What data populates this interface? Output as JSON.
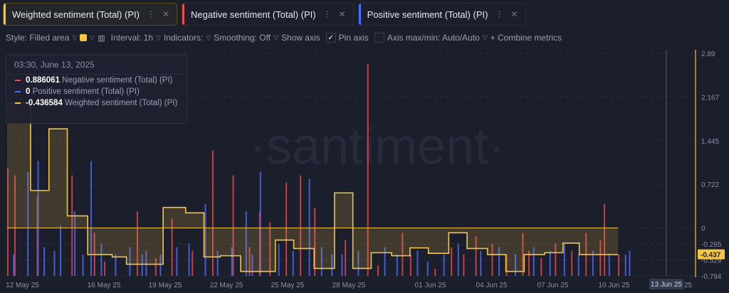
{
  "tabs": [
    {
      "label": "Weighted sentiment (Total) (PI)",
      "color": "#f5c542",
      "active": true
    },
    {
      "label": "Negative sentiment (Total) (PI)",
      "color": "#ef4b4b",
      "active": false
    },
    {
      "label": "Positive sentiment (Total) (PI)",
      "color": "#4b6bff",
      "active": false
    }
  ],
  "toolbar": {
    "style": "Style: Filled area",
    "interval": "Interval: 1h",
    "indicators": "Indicators:",
    "smoothing": "Smoothing: Off",
    "show_axis": "Show axis",
    "pin_axis": "Pin axis",
    "axis_maxmin": "Axis max/min: Auto/Auto",
    "combine": "+ Combine metrics",
    "check": "✓"
  },
  "tooltip": {
    "date": "03:30, June 13, 2025",
    "rows": [
      {
        "value": "0.886061",
        "label": "Negative sentiment (Total) (PI)",
        "color": "#ef4b4b"
      },
      {
        "value": "0",
        "label": "Positive sentiment (Total) (PI)",
        "color": "#4b6bff"
      },
      {
        "value": "-0.436584",
        "label": "Weighted sentiment (Total) (PI)",
        "color": "#f5c542"
      }
    ]
  },
  "watermark": "·santiment·",
  "chart_data": {
    "type": "area",
    "x_ticks": [
      {
        "day": 0,
        "label": "12 May 25"
      },
      {
        "day": 4,
        "label": "16 May 25"
      },
      {
        "day": 7,
        "label": "19 May 25"
      },
      {
        "day": 10,
        "label": "22 May 25"
      },
      {
        "day": 13,
        "label": "25 May 25"
      },
      {
        "day": 16,
        "label": "28 May 25"
      },
      {
        "day": 20,
        "label": "01 Jun 25"
      },
      {
        "day": 23,
        "label": "04 Jun 25"
      },
      {
        "day": 26,
        "label": "07 Jun 25"
      },
      {
        "day": 29,
        "label": "10 Jun 25"
      },
      {
        "day": 32.3,
        "label": "Jun 25"
      }
    ],
    "cursor_label": "13 Jun 25",
    "y_ticks": [
      "2.89",
      "2.167",
      "1.445",
      "0.722",
      "0",
      "-0.265",
      "-0.529",
      "-0.794"
    ],
    "y_tick_values": [
      2.89,
      2.167,
      1.445,
      0.722,
      0,
      -0.265,
      -0.529,
      -0.794
    ],
    "ylim": [
      -0.794,
      2.89
    ],
    "xlim": [
      -0.75,
      33
    ],
    "current_value": "-0.437",
    "weighted_steps": [
      [
        -0.75,
        2.07
      ],
      [
        0.4,
        0.62
      ],
      [
        1.3,
        1.64
      ],
      [
        2.2,
        0.2
      ],
      [
        3.2,
        -0.44
      ],
      [
        4.4,
        -0.48
      ],
      [
        5.1,
        -0.6
      ],
      [
        6.9,
        0.34
      ],
      [
        8,
        0.25
      ],
      [
        8.9,
        -0.48
      ],
      [
        9.7,
        -0.46
      ],
      [
        10.7,
        -0.72
      ],
      [
        12.4,
        -0.2
      ],
      [
        13.3,
        -0.34
      ],
      [
        14.3,
        -0.67
      ],
      [
        15.3,
        0.58
      ],
      [
        16.2,
        -0.67
      ],
      [
        17.1,
        -0.41
      ],
      [
        18.1,
        -0.46
      ],
      [
        19,
        -0.33
      ],
      [
        19.9,
        -0.42
      ],
      [
        20.9,
        -0.08
      ],
      [
        21.8,
        -0.34
      ],
      [
        22.8,
        -0.44
      ],
      [
        23.7,
        -0.72
      ],
      [
        24.6,
        -0.44
      ],
      [
        25.6,
        -0.41
      ],
      [
        26.5,
        -0.25
      ],
      [
        27.3,
        -0.44
      ],
      [
        28.2,
        -0.44
      ]
    ],
    "weighted_end_day": 28.2,
    "negative_bars": [
      [
        -0.75,
        1.5
      ],
      [
        -0.4,
        1.4
      ],
      [
        0.7,
        1.1
      ],
      [
        2.4,
        1.4
      ],
      [
        4,
        0.2
      ],
      [
        5.6,
        0.9
      ],
      [
        6.5,
        0.25
      ],
      [
        8.3,
        0.35
      ],
      [
        9.3,
        1.75
      ],
      [
        10.3,
        1.4
      ],
      [
        11.1,
        0.4
      ],
      [
        12.1,
        0.75
      ],
      [
        12.9,
        1.3
      ],
      [
        13.6,
        1.4
      ],
      [
        14.3,
        0.95
      ],
      [
        16.9,
        2.95
      ],
      [
        17.4,
        0.15
      ],
      [
        19,
        0.3
      ],
      [
        20.2,
        0.1
      ],
      [
        21.6,
        0.3
      ],
      [
        23,
        0.45
      ],
      [
        23.7,
        0.3
      ],
      [
        24.5,
        0.6
      ],
      [
        24.8,
        0.35
      ],
      [
        25.4,
        0.25
      ],
      [
        26.9,
        0.35
      ],
      [
        28.3,
        0.5
      ],
      [
        28.5,
        1.0
      ],
      [
        29.2,
        0.3
      ],
      [
        3.5,
        0.6
      ],
      [
        7.3,
        0.8
      ],
      [
        11.6,
        0.9
      ],
      [
        15.8,
        0.5
      ],
      [
        18.6,
        0.6
      ],
      [
        21,
        0.4
      ],
      [
        22.2,
        0.55
      ],
      [
        26.1,
        0.45
      ],
      [
        27.6,
        0.6
      ]
    ],
    "positive_bars": [
      [
        0.2,
        1.45
      ],
      [
        0.7,
        1.6
      ],
      [
        1.8,
        0.7
      ],
      [
        2.5,
        0.9
      ],
      [
        3.3,
        1.6
      ],
      [
        5.8,
        0.3
      ],
      [
        8.9,
        1.0
      ],
      [
        10.9,
        0.9
      ],
      [
        11.6,
        1.45
      ],
      [
        14,
        1.35
      ],
      [
        15.6,
        0.3
      ],
      [
        19.8,
        0.2
      ],
      [
        -0.5,
        0.3
      ],
      [
        1,
        0.4
      ],
      [
        1.5,
        0.35
      ],
      [
        2.9,
        0.3
      ],
      [
        3.8,
        0.45
      ],
      [
        4.5,
        0.3
      ],
      [
        5.2,
        0.4
      ],
      [
        6,
        0.35
      ],
      [
        6.7,
        0.3
      ],
      [
        7.5,
        0.4
      ],
      [
        8.1,
        0.45
      ],
      [
        9.5,
        0.35
      ],
      [
        10.2,
        0.4
      ],
      [
        11.2,
        0.3
      ],
      [
        12.5,
        0.45
      ],
      [
        13.2,
        0.35
      ],
      [
        14.6,
        0.4
      ],
      [
        15.1,
        0.3
      ],
      [
        16.4,
        0.35
      ],
      [
        17.7,
        0.4
      ],
      [
        18.3,
        0.3
      ],
      [
        19.3,
        0.35
      ],
      [
        20.6,
        0.3
      ],
      [
        21.3,
        0.45
      ],
      [
        22.4,
        0.35
      ],
      [
        23.3,
        0.4
      ],
      [
        24.1,
        0.3
      ],
      [
        25,
        0.4
      ],
      [
        25.8,
        0.35
      ],
      [
        26.5,
        0.45
      ],
      [
        27.2,
        0.3
      ],
      [
        27.9,
        0.35
      ],
      [
        28.7,
        0.3
      ],
      [
        29.5,
        0.3
      ],
      [
        29.7,
        0.35
      ]
    ]
  }
}
